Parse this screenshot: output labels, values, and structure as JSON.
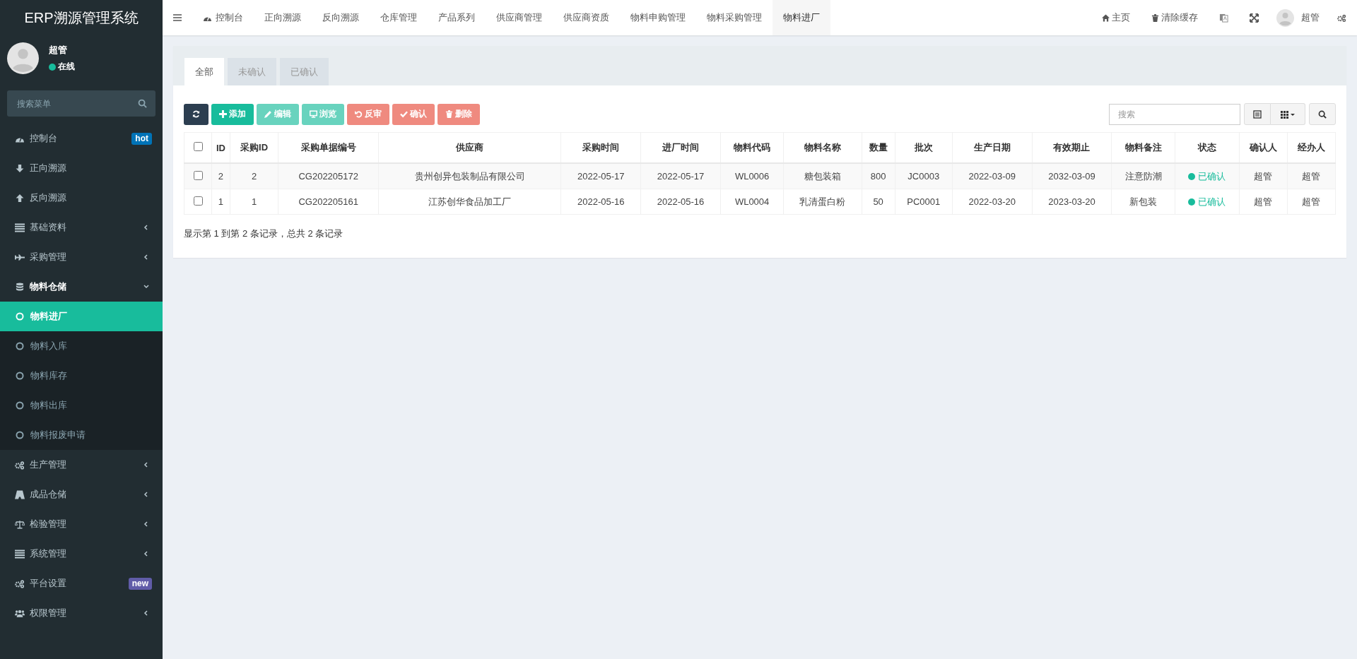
{
  "sidebar": {
    "logo": "ERP溯源管理系统",
    "user": {
      "name": "超管",
      "status": "在线",
      "online": true
    },
    "search": {
      "placeholder": "搜索菜单"
    },
    "items": [
      {
        "label": "控制台",
        "badge": "hot",
        "color": "#0073b7",
        "selected": false
      },
      {
        "label": "正向溯源",
        "selected": false
      },
      {
        "label": "反向溯源",
        "selected": false
      },
      {
        "label": "基础资料",
        "expanded": false,
        "selected": false
      },
      {
        "label": "采购管理",
        "expanded": false,
        "selected": false
      },
      {
        "label": "物料仓储",
        "expanded": true,
        "selected": false,
        "children": [
          {
            "label": "物料进厂",
            "selected": true
          },
          {
            "label": "物料入库",
            "selected": false
          },
          {
            "label": "物料库存",
            "selected": false
          },
          {
            "label": "物料出库",
            "selected": false
          },
          {
            "label": "物料报废申请",
            "selected": false
          }
        ]
      },
      {
        "label": "生产管理",
        "expanded": false,
        "selected": false
      },
      {
        "label": "成品仓储",
        "expanded": false,
        "selected": false
      },
      {
        "label": "检验管理",
        "expanded": false,
        "selected": false
      },
      {
        "label": "系统管理",
        "expanded": false,
        "selected": false
      },
      {
        "label": "平台设置",
        "badge": "new",
        "color": "#605ca8",
        "selected": false
      },
      {
        "label": "权限管理",
        "expanded": false,
        "selected": false
      }
    ]
  },
  "topbar": {
    "tabs": [
      {
        "label": "控制台",
        "selected": false
      },
      {
        "label": "正向溯源",
        "selected": false
      },
      {
        "label": "反向溯源",
        "selected": false
      },
      {
        "label": "仓库管理",
        "selected": false
      },
      {
        "label": "产品系列",
        "selected": false
      },
      {
        "label": "供应商管理",
        "selected": false
      },
      {
        "label": "供应商资质",
        "selected": false
      },
      {
        "label": "物料申购管理",
        "selected": false
      },
      {
        "label": "物料采购管理",
        "selected": false
      },
      {
        "label": "物料进厂",
        "selected": true
      }
    ],
    "home": "主页",
    "clear_cache": "清除缓存",
    "user": "超管"
  },
  "filter_tabs": [
    {
      "label": "全部",
      "selected": true
    },
    {
      "label": "未确认",
      "selected": false
    },
    {
      "label": "已确认",
      "selected": false
    }
  ],
  "toolbar": [
    {
      "kind": "refresh",
      "disabled": false
    },
    {
      "kind": "add",
      "label": "添加",
      "disabled": false
    },
    {
      "kind": "edit",
      "label": "编辑",
      "disabled": true
    },
    {
      "kind": "view",
      "label": "浏览",
      "disabled": true
    },
    {
      "kind": "revert",
      "label": "反审",
      "disabled": true
    },
    {
      "kind": "confirm",
      "label": "确认",
      "disabled": true
    },
    {
      "kind": "delete",
      "label": "删除",
      "disabled": true
    }
  ],
  "table_search": {
    "placeholder": "搜索"
  },
  "table": {
    "columns": [
      "ID",
      "采购ID",
      "采购单据编号",
      "供应商",
      "采购时间",
      "进厂时间",
      "物料代码",
      "物料名称",
      "数量",
      "批次",
      "生产日期",
      "有效期止",
      "物料备注",
      "状态",
      "确认人",
      "经办人"
    ],
    "all_checked": false,
    "rows": [
      {
        "checked": false,
        "cells": [
          "2",
          "2",
          "CG202205172",
          "贵州创异包装制品有限公司",
          "2022-05-17",
          "2022-05-17",
          "WL0006",
          "糖包装箱",
          "800",
          "JC0003",
          "2022-03-09",
          "2032-03-09",
          "注意防潮"
        ],
        "status": {
          "label": "已确认",
          "color": "#18bc9c"
        },
        "confirmer": "超管",
        "handler": "超管"
      },
      {
        "checked": false,
        "cells": [
          "1",
          "1",
          "CG202205161",
          "江苏创华食品加工厂",
          "2022-05-16",
          "2022-05-16",
          "WL0004",
          "乳清蛋白粉",
          "50",
          "PC0001",
          "2022-03-20",
          "2023-03-20",
          "新包装"
        ],
        "status": {
          "label": "已确认",
          "color": "#18bc9c"
        },
        "confirmer": "超管",
        "handler": "超管"
      }
    ]
  },
  "pagination_info": "显示第 1 到第 2 条记录，总共 2 条记录"
}
